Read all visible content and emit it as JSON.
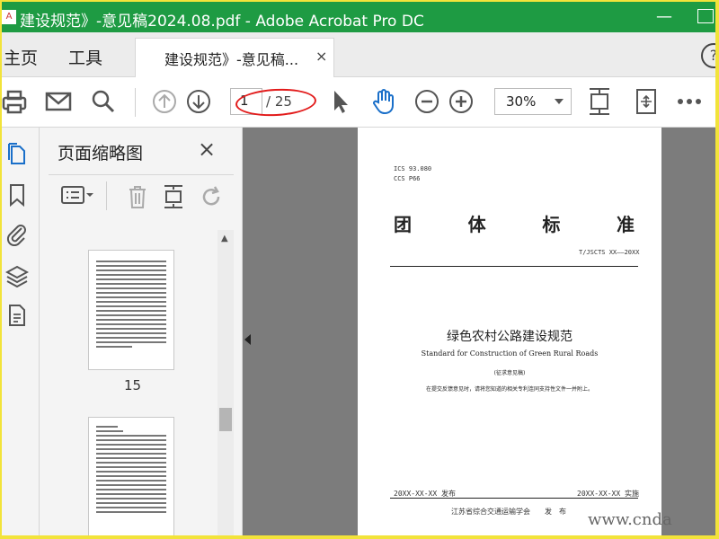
{
  "window": {
    "title": "建设规范》-意见稿2024.08.pdf - Adobe Acrobat Pro DC",
    "app_icon_label": "A"
  },
  "menu": {
    "home": "主页",
    "tools": "工具",
    "doc_tab": "建设规范》-意见稿...",
    "doc_tab_close": "×",
    "help": "?"
  },
  "toolbar": {
    "page_current": "1",
    "page_total": "/ 25",
    "zoom": "30%"
  },
  "panel": {
    "title": "页面缩略图",
    "close": "×",
    "thumbnails": [
      {
        "page": "15"
      },
      {
        "page": ""
      }
    ]
  },
  "document": {
    "ics": "ICS 93.080",
    "ccs": "CCS P66",
    "header_chars": [
      "团",
      "体",
      "标",
      "准"
    ],
    "standard_no": "T/JSCTS XX——20XX",
    "title_cn": "绿色农村公路建设规范",
    "title_en": "Standard for Construction of Green Rural Roads",
    "draft_label": "(征求意见稿)",
    "note": "在提交反馈意见时，请将您知道的相关专利连同支持性文件一并附上。",
    "publish_date": "20XX-XX-XX 发布",
    "implement_date": "20XX-XX-XX 实施",
    "publisher": "江苏省综合交通运输学会　　发　布"
  },
  "watermark": "www.cnda",
  "colors": {
    "titlebar": "#1e9b43",
    "annotation": "#e21b1b",
    "frame": "#f2e33a"
  }
}
